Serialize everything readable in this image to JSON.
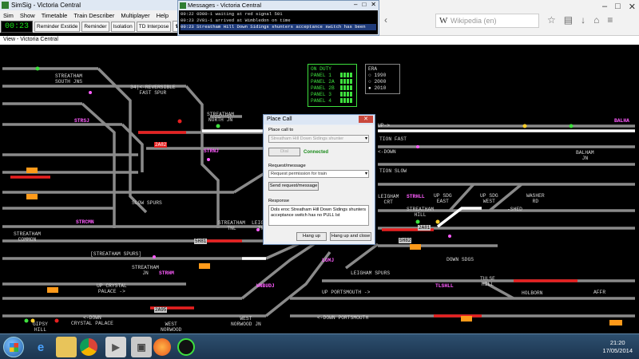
{
  "simsig": {
    "title": "SimSig - Victoria Central",
    "menu": [
      "Sim",
      "Show",
      "Timetable",
      "Train Describer",
      "Multiplayer",
      "Help"
    ],
    "clock": "00:23",
    "toolbar": [
      "Reminder Exstide",
      "Reminder",
      "Isolation",
      "TD Interpose"
    ]
  },
  "messages": {
    "title": "Messages - Victoria Central",
    "lines": [
      "00:22 0D80-1 waiting at red signal 501",
      "00:23 2V81-1 arrived at Wimbledon on time",
      "00:23 Streatham Hill Down Sidings shunters acceptance switch has been"
    ]
  },
  "browser": {
    "search_placeholder": "Wikipedia (en)"
  },
  "view": {
    "title": "View - Victoria Central"
  },
  "panel": {
    "duty_title": "ON DUTY",
    "duty": [
      "PANEL 1",
      "PANEL 2A",
      "PANEL 2B",
      "PANEL 3",
      "PANEL 4"
    ],
    "era_title": "ERA",
    "era": [
      "1990",
      "2000",
      "2010"
    ],
    "era_selected": "2010"
  },
  "labels": {
    "streatham_south_jns": "STREATHAM\nSOUTH JNS",
    "reversible_fast_spur": "34|<-REVERSIBLE\nFAST SPUR",
    "streatham_north_jn": "STREATHAM\nNORTH JN",
    "strsj": "STRSJ",
    "strnj": "STRNJ",
    "strcmn": "STRCMN",
    "strhm": "STRHM",
    "wnbudj": "WNBUDJ",
    "lgmj": "LGMJ",
    "strhll": "STRHLL",
    "tlshll": "TLSHLL",
    "slow_spurs": "SLOW SPURS",
    "streatham_spurs": "[STREATHAM SPURS]",
    "streatham_tnl": "STREATHAM\nTNL",
    "leigham_tnl": "LEIGHAM\nTNL",
    "streatham_jn": "STREATHAM\nJN",
    "streatham_common": "STREATHAM\nCOMMON",
    "up_crystal_palace": "UP CRYSTAL\nPALACE ->",
    "down_crystal_palace": "<-DOWN\nCRYSTAL PALACE",
    "gipsy_hill": "GIPSY\nHILL",
    "west_norwood": "WEST\nNORWOOD",
    "west_norwood_jn": "WEST\nNORWOOD JN",
    "up_portsmouth": "UP PORTSMOUTH ->",
    "down_portsmouth": "<-DOWN PORTSMOUTH",
    "leigham_spurs": "LEIGHAM SPURS",
    "streatham_hill": "STREATHAM\nHILL",
    "up_sdg_east": "UP SDG\nEAST",
    "up_sdg_west": "UP SDG\nWEST",
    "washer_rd": "WASHER\nRD",
    "shed": "-SHED",
    "down_sdgs": "DOWN SDGS",
    "balham_jn": "BALHAM\nJN",
    "balham": "BALHA",
    "holborn": "HOLBORN",
    "tulse_hill": "TULSE\nHILL",
    "affr": "AFFR",
    "up_fast": "UP->",
    "fast_down": "<-DOWN",
    "station_fast": "TION FAST",
    "station_slow": "TION SLOW",
    "leigham_crt": "LEIGHAM\nCRT"
  },
  "berths": [
    {
      "id": "2A82",
      "color": "red"
    },
    {
      "id": "2A81",
      "color": "grey"
    },
    {
      "id": "5H82",
      "color": "grey"
    },
    {
      "id": "5H81",
      "color": "grey"
    },
    {
      "id": "2A95",
      "color": "grey"
    }
  ],
  "dialog": {
    "title": "Place Call",
    "close": "✕",
    "call_to_label": "Place call to",
    "call_to_value": "Streatham Hill Down Sidings shunter",
    "dial_button": "Dial",
    "status": "Connected",
    "request_label": "Request/message",
    "request_value": "Request permission for train",
    "send_button": "Send request/message",
    "response_label": "Response",
    "response_text": "Dols eroc Streatham Hill Down Sidings shunters acceptance switch has no PULL lst",
    "hangup_button": "Hang up",
    "hangup_close_button": "Hang up and close"
  },
  "taskbar": {
    "time": "21:20",
    "date": "17/05/2014"
  },
  "colors": {
    "track": "#8a8a8a",
    "route_set": "#ffffff",
    "occupied": "#e82020",
    "berth": "#ff9a1a",
    "signal_green": "#3ee03e",
    "magenta": "#ff5cff"
  }
}
